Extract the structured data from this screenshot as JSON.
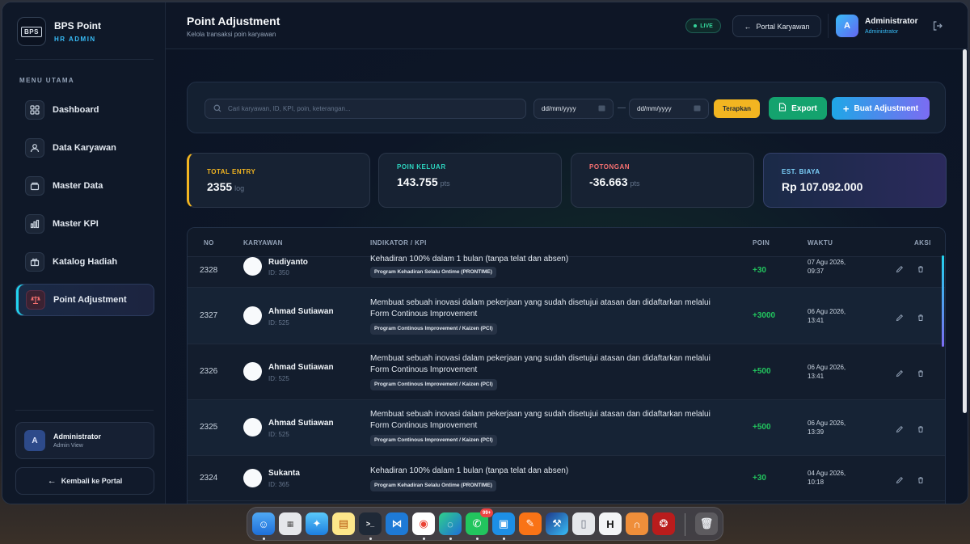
{
  "brand": {
    "logo": "BPS",
    "name": "BPS Point",
    "subtitle": "HR ADMIN"
  },
  "sidebar": {
    "menu_title": "MENU UTAMA",
    "items": [
      {
        "label": "Dashboard",
        "icon": "grid-icon"
      },
      {
        "label": "Data Karyawan",
        "icon": "users-icon"
      },
      {
        "label": "Master Data",
        "icon": "archive-icon"
      },
      {
        "label": "Master KPI",
        "icon": "bar-chart-icon"
      },
      {
        "label": "Katalog Hadiah",
        "icon": "gift-icon"
      },
      {
        "label": "Point Adjustment",
        "icon": "scale-icon",
        "active": true
      }
    ],
    "user": {
      "initial": "A",
      "name": "Administrator",
      "role": "Admin View"
    },
    "back_label": "Kembali ke Portal"
  },
  "header": {
    "title": "Point Adjustment",
    "subtitle": "Kelola transaksi poin karyawan",
    "live_label": "LIVE",
    "portal_label": "Portal Karyawan",
    "admin_initial": "A",
    "admin_name": "Administrator",
    "admin_role": "Administrator"
  },
  "toolbar": {
    "search_placeholder": "Cari karyawan, ID, KPI, poin, keterangan...",
    "date_from": "dd/mm/yyyy",
    "date_to": "dd/mm/yyyy",
    "date_separator": "—",
    "apply_label": "Terapkan",
    "export_label": "Export",
    "create_label": "Buat Adjustment"
  },
  "stats": [
    {
      "label": "TOTAL ENTRY",
      "value": "2355",
      "unit": "log",
      "color": "#f2b521"
    },
    {
      "label": "POIN KELUAR",
      "value": "143.755",
      "unit": "pts",
      "color": "#2dd4bf"
    },
    {
      "label": "POTONGAN",
      "value": "-36.663",
      "unit": "pts",
      "color": "#f87171"
    },
    {
      "label": "EST. BIAYA",
      "value": "Rp 107.092.000",
      "unit": "",
      "color": "#7dd3fc"
    }
  ],
  "table": {
    "headers": {
      "no": "NO",
      "karyawan": "KARYAWAN",
      "kpi": "INDIKATOR / KPI",
      "poin": "POIN",
      "waktu": "WAKTU",
      "aksi": "AKSI"
    },
    "rows": [
      {
        "no": "2328",
        "name": "Rudiyanto",
        "id": "ID: 350",
        "kpi": "Kehadiran 100% dalam 1 bulan (tanpa telat dan absen)",
        "tag": "Program Kehadiran Selalu Ontime (PRONTIME)",
        "points": "+30",
        "date": "07 Agu 2026,",
        "time": "09:37"
      },
      {
        "no": "2327",
        "name": "Ahmad Sutiawan",
        "id": "ID: 525",
        "kpi": "Membuat sebuah inovasi dalam pekerjaan yang sudah disetujui atasan dan didaftarkan melalui Form Continous Improvement",
        "tag": "Program Continous Improvement / Kaizen (PCI)",
        "points": "+3000",
        "date": "06 Agu 2026,",
        "time": "13:41"
      },
      {
        "no": "2326",
        "name": "Ahmad Sutiawan",
        "id": "ID: 525",
        "kpi": "Membuat sebuah inovasi dalam pekerjaan yang sudah disetujui atasan dan didaftarkan melalui Form Continous Improvement",
        "tag": "Program Continous Improvement / Kaizen (PCI)",
        "points": "+500",
        "date": "06 Agu 2026,",
        "time": "13:41"
      },
      {
        "no": "2325",
        "name": "Ahmad Sutiawan",
        "id": "ID: 525",
        "kpi": "Membuat sebuah inovasi dalam pekerjaan yang sudah disetujui atasan dan didaftarkan melalui Form Continous Improvement",
        "tag": "Program Continous Improvement / Kaizen (PCI)",
        "points": "+500",
        "date": "06 Agu 2026,",
        "time": "13:39"
      },
      {
        "no": "2324",
        "name": "Sukanta",
        "id": "ID: 365",
        "kpi": "Kehadiran 100% dalam 1 bulan (tanpa telat dan absen)",
        "tag": "Program Kehadiran Selalu Ontime (PRONTIME)",
        "points": "+30",
        "date": "04 Agu 2026,",
        "time": "10:18"
      }
    ]
  },
  "dock": {
    "whatsapp_badge": "99+",
    "apps": [
      "finder-icon",
      "launchpad-icon",
      "safari-icon",
      "notes-icon",
      "terminal-icon",
      "vscode-icon",
      "chrome-icon",
      "edge-icon",
      "whatsapp-icon",
      "docker-icon",
      "postman-icon",
      "xcode-icon",
      "preview-icon",
      "hammer-icon",
      "headset-icon",
      "shield-app-icon",
      "trash-icon"
    ]
  }
}
